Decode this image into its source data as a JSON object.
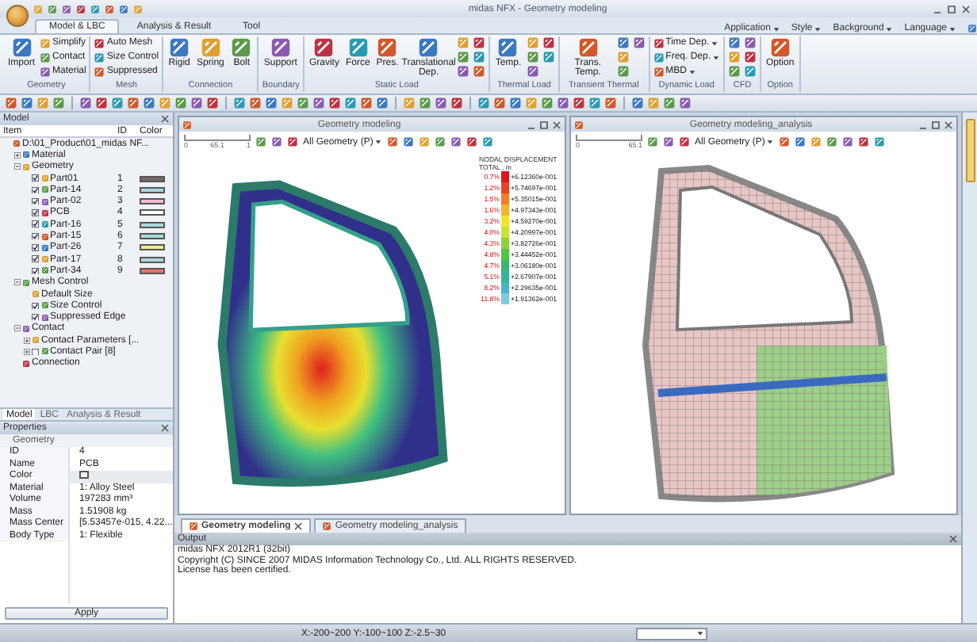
{
  "window": {
    "title": "midas NFX - Geometry modeling"
  },
  "ribbon": {
    "tabs": [
      {
        "label": "Model & LBC",
        "selected": true
      },
      {
        "label": "Analysis & Result",
        "selected": false
      },
      {
        "label": "Tool",
        "selected": false
      }
    ],
    "menus": [
      "Application",
      "Style",
      "Background",
      "Language"
    ],
    "groups": [
      {
        "label": "Geometry",
        "buttons": [
          {
            "kind": "large",
            "label": "Import"
          },
          {
            "kind": "small",
            "label": "Simplify"
          },
          {
            "kind": "small",
            "label": "Contact"
          },
          {
            "kind": "small",
            "label": "Material"
          }
        ]
      },
      {
        "label": "Mesh",
        "buttons": [
          {
            "kind": "small",
            "label": "Auto Mesh"
          },
          {
            "kind": "small",
            "label": "Size Control"
          },
          {
            "kind": "small",
            "label": "Suppressed"
          }
        ]
      },
      {
        "label": "Connection",
        "buttons": [
          {
            "kind": "large",
            "label": "Rigid"
          },
          {
            "kind": "large",
            "label": "Spring"
          },
          {
            "kind": "large",
            "label": "Bolt"
          }
        ]
      },
      {
        "label": "Boundary",
        "buttons": [
          {
            "kind": "large",
            "label": "Support"
          }
        ]
      },
      {
        "label": "Static Load",
        "buttons": [
          {
            "kind": "large",
            "label": "Gravity"
          },
          {
            "kind": "large",
            "label": "Force"
          },
          {
            "kind": "large",
            "label": "Pres."
          },
          {
            "kind": "large",
            "label": "Translational Dep."
          },
          {
            "kind": "icon"
          },
          {
            "kind": "icon"
          },
          {
            "kind": "icon"
          },
          {
            "kind": "icon"
          },
          {
            "kind": "icon"
          },
          {
            "kind": "icon"
          }
        ]
      },
      {
        "label": "Thermal Load",
        "buttons": [
          {
            "kind": "large",
            "label": "Temp."
          },
          {
            "kind": "icon"
          },
          {
            "kind": "icon"
          },
          {
            "kind": "icon"
          },
          {
            "kind": "icon"
          },
          {
            "kind": "icon"
          }
        ]
      },
      {
        "label": "Transient Thermal",
        "buttons": [
          {
            "kind": "large",
            "label": "Trans. Temp."
          },
          {
            "kind": "icon"
          },
          {
            "kind": "icon"
          },
          {
            "kind": "icon"
          },
          {
            "kind": "icon"
          }
        ]
      },
      {
        "label": "Dynamic Load",
        "buttons": [
          {
            "kind": "dropdown",
            "label": "Time Dep."
          },
          {
            "kind": "dropdown",
            "label": "Freq. Dep."
          },
          {
            "kind": "dropdown",
            "label": "MBD"
          }
        ]
      },
      {
        "label": "CFD",
        "buttons": [
          {
            "kind": "icon"
          },
          {
            "kind": "icon"
          },
          {
            "kind": "icon"
          },
          {
            "kind": "icon"
          },
          {
            "kind": "icon"
          },
          {
            "kind": "icon"
          }
        ]
      },
      {
        "label": "Option",
        "buttons": [
          {
            "kind": "large",
            "label": "Option"
          }
        ]
      }
    ]
  },
  "model_panel": {
    "title": "Model",
    "columns": [
      "Item",
      "ID",
      "Color"
    ],
    "tree": [
      {
        "label": "D:\\01_Product\\01_midas NF...",
        "children": [
          {
            "label": "Material",
            "expanded": false
          },
          {
            "label": "Geometry",
            "expanded": true,
            "children": [
              {
                "kind": "check",
                "label": "Part01",
                "checked": true,
                "id": "1",
                "color": "#736b68"
              },
              {
                "kind": "check",
                "label": "Part-14",
                "checked": true,
                "id": "2",
                "color": "#a7d9df"
              },
              {
                "kind": "check",
                "label": "Part-02",
                "checked": true,
                "id": "3",
                "color": "#f3b8d6"
              },
              {
                "kind": "check",
                "label": "PCB",
                "checked": true,
                "id": "4",
                "color": "#ffffff"
              },
              {
                "kind": "check",
                "label": "Part-16",
                "checked": true,
                "id": "5",
                "color": "#a7d9df"
              },
              {
                "kind": "check",
                "label": "Part-15",
                "checked": true,
                "id": "6",
                "color": "#a7d9df"
              },
              {
                "kind": "check",
                "label": "Part-26",
                "checked": true,
                "id": "7",
                "color": "#f2ec8a"
              },
              {
                "kind": "check",
                "label": "Part-17",
                "checked": true,
                "id": "8",
                "color": "#a7d9df"
              },
              {
                "kind": "check",
                "label": "Part-34",
                "checked": true,
                "id": "9",
                "color": "#ee6f6f"
              }
            ]
          },
          {
            "label": "Mesh Control",
            "expanded": true,
            "children": [
              {
                "kind": "plain",
                "label": "Default Size"
              },
              {
                "kind": "check",
                "label": "Size Control",
                "checked": true
              },
              {
                "kind": "check",
                "label": "Suppressed Edge",
                "checked": true
              }
            ]
          },
          {
            "label": "Contact",
            "expanded": true,
            "children": [
              {
                "kind": "plain",
                "label": "Contact Parameters [...",
                "expanded": false
              },
              {
                "kind": "check",
                "label": "Contact Pair [8]",
                "checked": false,
                "expanded": false
              }
            ]
          },
          {
            "label": "Connection"
          }
        ]
      }
    ],
    "tabs": [
      {
        "label": "Model",
        "selected": true
      },
      {
        "label": "LBC",
        "selected": false
      },
      {
        "label": "Analysis & Result",
        "selected": false
      }
    ]
  },
  "properties": {
    "title": "Properties",
    "section": "Geometry",
    "rows": [
      {
        "kind": "text",
        "label": "ID",
        "value": "4"
      },
      {
        "kind": "text",
        "label": "Name",
        "value": "PCB"
      },
      {
        "kind": "color",
        "label": "Color",
        "color": "#ffffff"
      },
      {
        "kind": "text",
        "label": "Material",
        "value": "1: Alloy Steel"
      },
      {
        "kind": "text",
        "label": "Volume",
        "value": "197283 mm³"
      },
      {
        "kind": "text",
        "label": "Mass",
        "value": "1.51908 kg"
      },
      {
        "kind": "text",
        "label": "Mass Center",
        "value": "[5.53457e-015, 4.22..."
      },
      {
        "kind": "text",
        "label": "Body Type",
        "value": "1: Flexible"
      }
    ],
    "apply": "Apply"
  },
  "viewports": [
    {
      "kind": "contour",
      "title": "Geometry modeling",
      "scale": [
        "0",
        "65.1",
        "1"
      ],
      "filter": "All Geometry (P)",
      "legend": {
        "title": "NODAL DISPLACEMENT",
        "subtitle": "TOTAL , m",
        "entries": [
          {
            "percent": "0.7%",
            "value": "+6.12360e-001",
            "color": "#d7191c"
          },
          {
            "percent": "1.2%",
            "value": "+5.74697e-001",
            "color": "#e8412a"
          },
          {
            "percent": "1.5%",
            "value": "+5.35015e-001",
            "color": "#f07e2a"
          },
          {
            "percent": "1.6%",
            "value": "+4.97343e-001",
            "color": "#f5b32f"
          },
          {
            "percent": "3.2%",
            "value": "+4.59270e-001",
            "color": "#f2e52e"
          },
          {
            "percent": "4.0%",
            "value": "+4.20997e-001",
            "color": "#c9e23a"
          },
          {
            "percent": "4.3%",
            "value": "+3.82726e-001",
            "color": "#8fd13f"
          },
          {
            "percent": "4.8%",
            "value": "+3.44452e-001",
            "color": "#55c24a"
          },
          {
            "percent": "4.7%",
            "value": "+3.06180e-001",
            "color": "#3cb371"
          },
          {
            "percent": "5.1%",
            "value": "+2.67907e-001",
            "color": "#37b39a"
          },
          {
            "percent": "8.2%",
            "value": "+2.29635e-001",
            "color": "#4ab4c8"
          },
          {
            "percent": "11.8%",
            "value": "+1.91362e-001",
            "color": "#7ecbe0"
          }
        ]
      }
    },
    {
      "kind": "mesh",
      "title": "Geometry modeling_analysis",
      "scale": [
        "0",
        "65.1"
      ],
      "filter": "All Geometry (P)"
    }
  ],
  "doc_tabs": [
    {
      "label": "Geometry modeling",
      "selected": true
    },
    {
      "label": "Geometry modeling_analysis",
      "selected": false
    }
  ],
  "output": {
    "title": "Output",
    "lines": [
      "midas NFX 2012R1 (32bit)",
      "Copyright (C) SINCE 2007 MIDAS Information Technology Co., Ltd. ALL RIGHTS RESERVED.",
      "License has been certified."
    ]
  },
  "status_bar": {
    "coordinates": "X:-200~200 Y:-100~100 Z:-2.5~30"
  }
}
